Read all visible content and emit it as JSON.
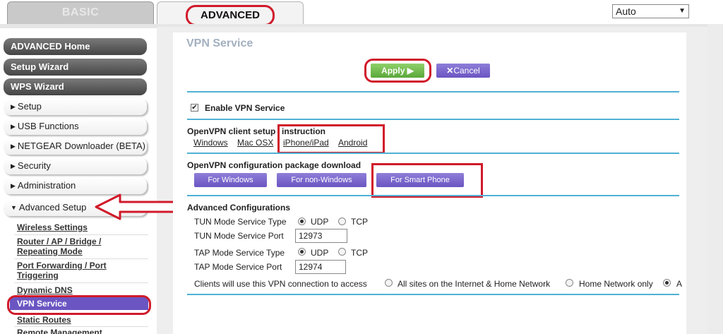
{
  "tabs": {
    "basic": "BASIC",
    "advanced": "ADVANCED"
  },
  "language_select": {
    "value": "Auto"
  },
  "sidebar": {
    "main_items": [
      "ADVANCED Home",
      "Setup Wizard",
      "WPS Wizard"
    ],
    "sections": [
      "Setup",
      "USB Functions",
      "NETGEAR Downloader (BETA)",
      "Security",
      "Administration",
      "Advanced Setup"
    ],
    "advanced_setup_items": [
      "Wireless Settings",
      "Router / AP / Bridge /",
      "Repeating Mode",
      "Port Forwarding / Port",
      "Triggering",
      "Dynamic DNS",
      "VPN Service",
      "Static Routes",
      "Remote Management"
    ]
  },
  "page": {
    "title": "VPN Service",
    "apply_label": "Apply ▶",
    "cancel_label": "Cancel",
    "enable_vpn_label": "Enable VPN Service",
    "enable_vpn_checked": true,
    "client_setup": {
      "label_a": "OpenVPN client setup",
      "label_b": "instruction",
      "links": [
        "Windows",
        "Mac OSX",
        "iPhone/iPad",
        "Android"
      ]
    },
    "config_download": {
      "label": "OpenVPN configuration package download",
      "buttons": [
        "For Windows",
        "For non-Windows",
        "For Smart Phone"
      ]
    },
    "advanced": {
      "heading": "Advanced Configurations",
      "tun_type_label": "TUN Mode Service Type",
      "tun_port_label": "TUN Mode Service Port",
      "tun_port_value": "12973",
      "tap_type_label": "TAP Mode Service Type",
      "tap_port_label": "TAP Mode Service Port",
      "tap_port_value": "12974",
      "udp": "UDP",
      "tcp": "TCP",
      "clients_label": "Clients will use this VPN connection to access",
      "access_options": [
        "All sites on the Internet & Home Network",
        "Home Network only",
        "A"
      ]
    }
  },
  "colors": {
    "accent_red": "#d01a2a",
    "purple": "#6b55c2",
    "green": "#5aa83a",
    "rule_blue": "#4fb1d4"
  }
}
